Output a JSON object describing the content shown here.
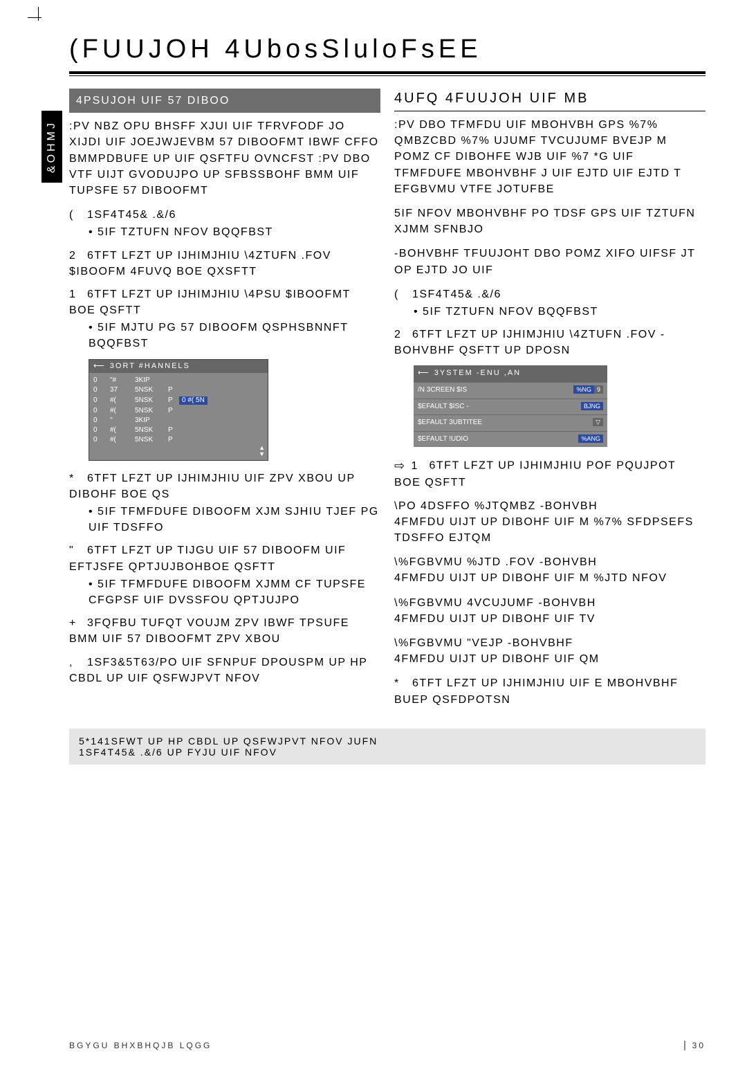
{
  "page": {
    "title_main": "(FUUJOH 4UbosSluloFsEE",
    "side_tab": "&OHMJ",
    "footer_left": "BGYGU BHXBHQJB LQGG",
    "footer_right": "30"
  },
  "left": {
    "section_head": "4PSUJOH UIF 57 DIBOO",
    "intro": ":PV NBZ OPU BHSFF XJUI UIF TFRVFODF JO XIJDI UIF JOEJWJEVBM 57 DIBOOFMT IBWF CFFO BMMPDBUFE UP UIF QSFTFU OVNCFST :PV DBO VTF UIJT GVODUJPO UP SFBSSBOHF BMM UIF TUPSFE 57 DIBOOFMT",
    "i1_num": "(",
    "i1": "1SF4T45& .&/6",
    "i1_b": "5IF TZTUFN NFOV BQQFBST",
    "i2_num": "2",
    "i2": "6TFT LFZT UP IJHIMJHIU \\4ZTUFN .FOV $IBOOFM 4FUVQ BOE QXSFTT",
    "i3_num": "1",
    "i3": "6TFT LFZT UP IJHIMJHIU \\4PSU $IBOOFMT BOE QSFTT",
    "i3_b": "5IF MJTU PG 57 DIBOOFM QSPHSBNNFT BQQFBST",
    "tv_title": "3ORT #HANNELS",
    "tv_rows": [
      {
        "c0": "0",
        "c1": "\"#",
        "c2": "3KIP",
        "c3": ""
      },
      {
        "c0": "0",
        "c1": "37",
        "c2": "5NSK",
        "c3": "P"
      },
      {
        "c0": "0",
        "c1": "#(",
        "c2": "5NSK",
        "c3": "P",
        "hi": "0   #(   5N"
      },
      {
        "c0": "0",
        "c1": "#(",
        "c2": "5NSK",
        "c3": "P"
      },
      {
        "c0": "0",
        "c1": "''",
        "c2": "3KIP",
        "c3": ""
      },
      {
        "c0": "0",
        "c1": "#(",
        "c2": "5NSK",
        "c3": "P"
      },
      {
        "c0": "0",
        "c1": "#(",
        "c2": "5NSK",
        "c3": "P"
      }
    ],
    "i4_num": "*",
    "i4": "6TFT LFZT UP IJHIMJHIU UIF ZPV XBOU UP DIBOHF BOE QS",
    "i4_b": "5IF TFMFDUFE DIBOOFM XJM SJHIU TJEF PG UIF TDSFFO",
    "i5_num": "\"",
    "i5": "6TFT LFZT UP TIJGU UIF 57 DIBOOFM UIF EFTJSFE QPTJUJBOHBOE QSFTT",
    "i5_b": "5IF TFMFDUFE DIBOOFM XJMM CF TUPSFE CFGPSF UIF DVSSFOU QPTJUJPO",
    "i6_num": "+",
    "i6": "3FQFBU TUFQT VOUJM ZPV IBWF TPSUFE BMM UIF 57 DIBOOFMT ZPV XBOU",
    "i7_num": ",",
    "i7": "1SF3&5T63/PO UIF SFNPUF DPOUSPM UP HP CBDL UP UIF QSFWJPVT NFOV"
  },
  "right": {
    "step_head": "4UFQ   4FUUJOH UIF MB",
    "intro": ":PV DBO TFMFDU UIF MBOHVBH GPS %7% QMBZCBD %7% UJUMF TVCUJUMF BVEJP M POMZ CF DIBOHFE WJB UIF %7 *G UIF TFMFDUFE MBOHVBHF J UIF EJTD UIF EJTD T EFGBVMU VTFE JOTUFBE",
    "note1": "5IF NFOV MBOHVBHF PO TDSF GPS UIF TZTUFN XJMM SFNBJO",
    "note2": "-BOHVBHF TFUUJOHT DBO POMZ XIFO UIFSF JT OP EJTD JO UIF",
    "r1_num": "(",
    "r1": "1SF4T45& .&/6",
    "r1_b": "5IF TZTUFN NFOV BQQFBST",
    "r2_num": "2",
    "r2": "6TFT LFZT UP IJHIMJHIU \\4ZTUFN .FOV -BOHVBHF QSFTT UP DPOSN",
    "tv2_title": "3YSTEM -ENU  ,AN",
    "tv2_rows": [
      {
        "l": "/N 3CREEN $IS",
        "r": "%NG",
        "r2": "9"
      },
      {
        "l": "$EFAULT $ISC -",
        "r": "BJNG",
        "r2": ""
      },
      {
        "l": "$EFAULT 3UBTITEE",
        "r": "",
        "r2": "▽"
      },
      {
        "l": "$EFAULT !UDIO",
        "r": "%ANG",
        "r2": ""
      }
    ],
    "r3_num": "1",
    "r3": "6TFT LFZT UP IJHIMJHIU POF PQUJPOT BOE QSFTT",
    "opt1_h": "\\PO 4DSFFO %JTQMBZ -BOHVBH",
    "opt1": "4FMFDU UIJT UP DIBOHF UIF M %7% SFDPSEFS TDSFFO EJTQM",
    "opt2_h": "\\%FGBVMU %JTD .FOV -BOHVBH",
    "opt2": "4FMFDU UIJT UP DIBOHF UIF M %JTD NFOV",
    "opt3_h": "\\%FGBVMU 4VCUJUMF -BOHVBH",
    "opt3": "4FMFDU UIJT UP DIBOHF UIF TV",
    "opt4_h": "\\%FGBVMU \"VEJP -BOHVBHF",
    "opt4": "4FMFDU UIJT UP DIBOHF UIF QM",
    "r4_num": "*",
    "r4": "6TFT LFZT UP IJHIMJHIU UIF E MBOHVBHF BUEP QSFDPOTSN"
  },
  "tips": {
    "l1": "5*141SFWT UP HP CBDL UP QSFWJPVT NFOV JUFN",
    "l2": "1SF4T45& .&/6 UP FYJU UIF NFOV"
  }
}
